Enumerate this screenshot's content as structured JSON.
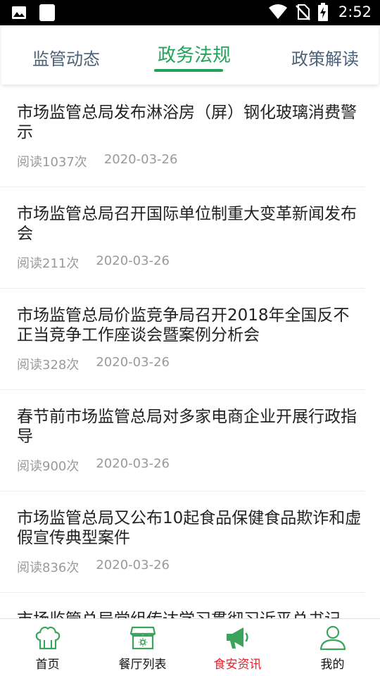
{
  "status_bar": {
    "time": "2:52",
    "icons": [
      "image-icon",
      "blank-square-icon",
      "wifi-icon",
      "no-sim-icon",
      "battery-charging-icon"
    ]
  },
  "tabs": [
    {
      "label": "监管动态",
      "active": false
    },
    {
      "label": "政务法规",
      "active": true
    },
    {
      "label": "政策解读",
      "active": false
    }
  ],
  "news": [
    {
      "title": "市场监管总局发布淋浴房（屏）钢化玻璃消费警示",
      "reads": "阅读1037次",
      "date": "2020-03-26"
    },
    {
      "title": "市场监管总局召开国际单位制重大变革新闻发布会",
      "reads": "阅读211次",
      "date": "2020-03-26"
    },
    {
      "title": "市场监管总局价监竞争局召开2018年全国反不正当竞争工作座谈会暨案例分析会",
      "reads": "阅读328次",
      "date": "2020-03-26"
    },
    {
      "title": "春节前市场监管总局对多家电商企业开展行政指导",
      "reads": "阅读900次",
      "date": "2020-03-26"
    },
    {
      "title": "市场监管总局又公布10起食品保健食品欺诈和虚假宣传典型案件",
      "reads": "阅读836次",
      "date": "2020-03-26"
    },
    {
      "title": "市场监管总局党组传达学习贯彻习近平总书记",
      "reads": "",
      "date": ""
    }
  ],
  "bottom_nav": [
    {
      "label": "首页",
      "icon": "chef-hat-icon",
      "active": false
    },
    {
      "label": "餐厅列表",
      "icon": "restaurant-store-icon",
      "active": false
    },
    {
      "label": "食安资讯",
      "icon": "megaphone-icon",
      "active": true
    },
    {
      "label": "我的",
      "icon": "user-icon",
      "active": false
    }
  ],
  "colors": {
    "accent_green": "#22a35a",
    "active_nav_red": "#e8212c",
    "icon_green": "#3aa55a"
  }
}
